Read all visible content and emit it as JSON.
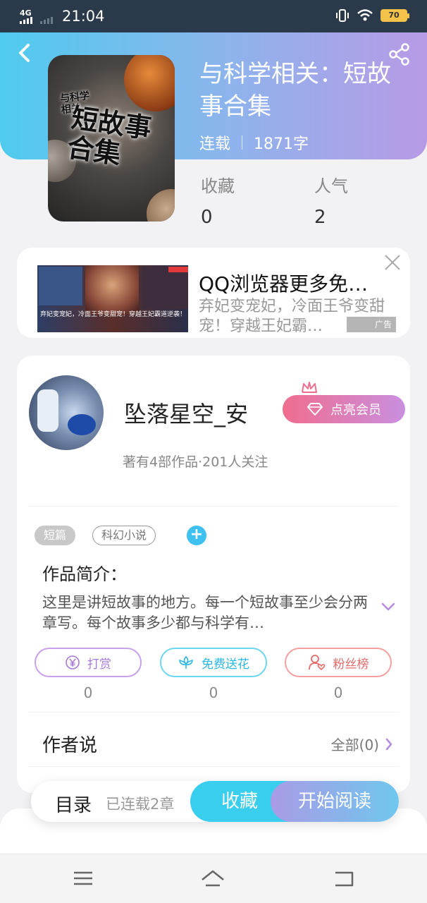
{
  "status_bar": {
    "network": "4G",
    "time": "21:04",
    "battery": "70"
  },
  "book": {
    "title": "与科学相关：短故事合集",
    "status": "连载",
    "word_count": "1871字",
    "cover_subtitle": "与科学相关",
    "cover_title": "短故事合集",
    "stats": {
      "favorites_label": "收藏",
      "favorites_value": "0",
      "popularity_label": "人气",
      "popularity_value": "2"
    }
  },
  "ad": {
    "title": "QQ浏览器更多免…",
    "description": "弃妃变宠妃，冷面王爷变甜宠！穿越王妃霸…",
    "image_caption": "弃妃变宠妃，冷面王爷变甜宠！穿越王妃霸道逆袭！",
    "tag": "广告"
  },
  "author": {
    "name": "坠落星空_安",
    "vip_button": "点亮会员",
    "meta": "著有4部作品·201人关注"
  },
  "tags": {
    "items": [
      "短篇",
      "科幻小说"
    ],
    "add_label": "+"
  },
  "intro": {
    "heading": "作品简介：",
    "text": "这里是讲短故事的地方。每一个短故事至少会分两章写。每个故事多少都与科学有…"
  },
  "actions": [
    {
      "label": "打赏",
      "count": "0",
      "icon": "yuan-icon"
    },
    {
      "label": "免费送花",
      "count": "0",
      "icon": "flower-icon"
    },
    {
      "label": "粉丝榜",
      "count": "0",
      "icon": "fan-ranking-icon"
    }
  ],
  "author_says": {
    "heading": "作者说",
    "all_label": "全部(0)"
  },
  "bottom_bar": {
    "toc_label": "目录",
    "chapter_count": "已连载2章",
    "favorite_button": "收藏",
    "read_button": "开始阅读"
  },
  "colors": {
    "header_gradient_start": "#4fcbee",
    "header_gradient_end": "#b89ae6",
    "accent_blue": "#39cdee",
    "vip_pink": "#f06d8e"
  }
}
